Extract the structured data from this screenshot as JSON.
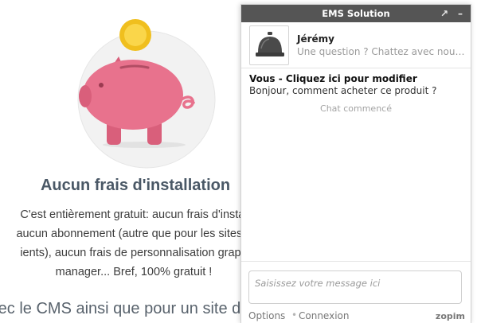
{
  "page": {
    "heading": "Aucun frais d'installation",
    "paragraph_lines": [
      "C'est entièrement gratuit: aucun frais d'instal",
      "aucun abonnement (autre que pour les sites c",
      "ients), aucun frais de personnalisation graph",
      "manager... Bref, 100% gratuit !"
    ],
    "footer_text": "rec le CMS ainsi que pour un site de"
  },
  "chat": {
    "title": "EMS Solution",
    "popout_icon": "↗",
    "minimize_icon": "–",
    "agent": {
      "name": "Jérémy",
      "subtitle": "Une question ? Chattez avec nous !",
      "avatar_icon": "service-bell-icon"
    },
    "message": {
      "name": "Vous - Cliquez ici pour modifier",
      "text": "Bonjour, comment acheter ce produit ?"
    },
    "status": "Chat commencé",
    "input": {
      "placeholder": "Saisissez votre message ici",
      "value": ""
    },
    "footer": {
      "options": "Options",
      "separator": "•",
      "connexion": "Connexion",
      "brand": "zopim"
    }
  },
  "colors": {
    "titlebar": "#555555",
    "piggy": "#e8728d",
    "coin": "#f5cc30",
    "circle": "#f2f2f2",
    "heading": "#4a5866"
  }
}
